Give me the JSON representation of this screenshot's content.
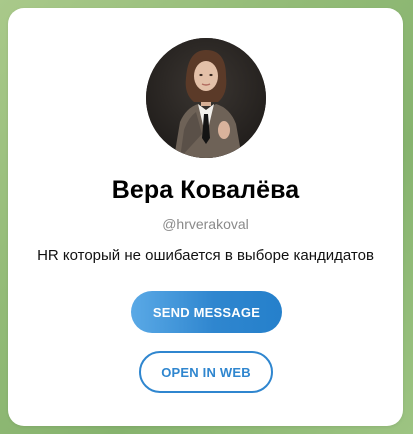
{
  "profile": {
    "name": "Вера Ковалёва",
    "username": "@hrverakoval",
    "bio": "HR который не ошибается в выборе кандидатов",
    "avatar_icon": "profile-photo"
  },
  "actions": {
    "send_message_label": "SEND MESSAGE",
    "open_web_label": "OPEN IN WEB"
  },
  "colors": {
    "accent": "#2f86cf",
    "background": "#93bb77",
    "card": "#ffffff"
  }
}
